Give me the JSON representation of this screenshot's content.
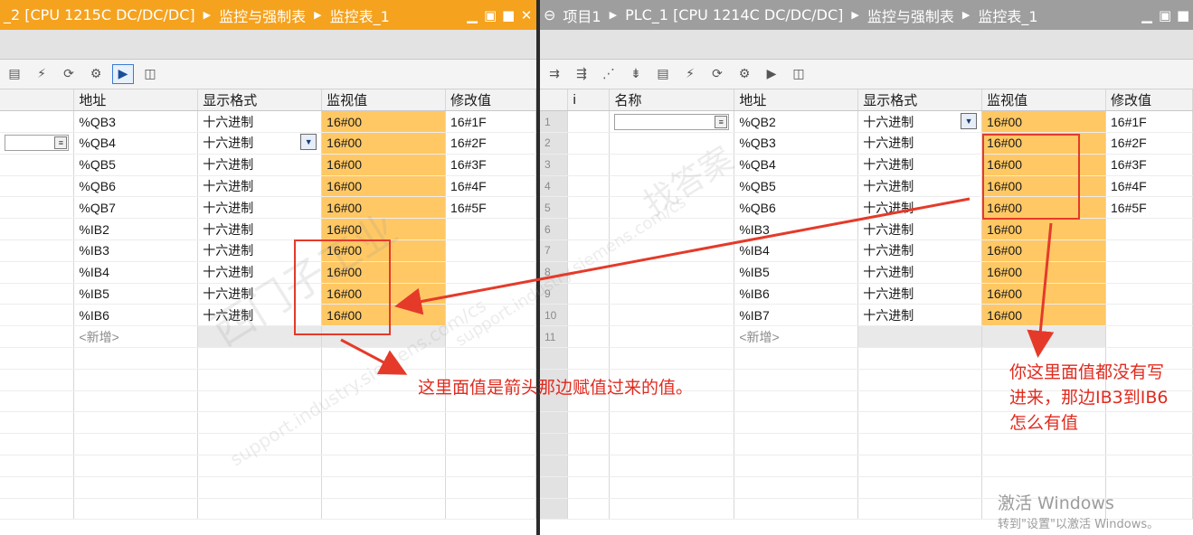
{
  "left": {
    "breadcrumb": [
      "_2 [CPU 1215C DC/DC/DC]",
      "监控与强制表",
      "监控表_1"
    ],
    "headers": [
      "地址",
      "显示格式",
      "监视值",
      "修改值"
    ],
    "rows": [
      {
        "addr": "%QB3",
        "fmt": "十六进制",
        "mon": "16#00",
        "mod": "16#1F"
      },
      {
        "addr": "%QB4",
        "fmt": "十六进制",
        "mon": "16#00",
        "mod": "16#2F"
      },
      {
        "addr": "%QB5",
        "fmt": "十六进制",
        "mon": "16#00",
        "mod": "16#3F"
      },
      {
        "addr": "%QB6",
        "fmt": "十六进制",
        "mon": "16#00",
        "mod": "16#4F"
      },
      {
        "addr": "%QB7",
        "fmt": "十六进制",
        "mon": "16#00",
        "mod": "16#5F"
      },
      {
        "addr": "%IB2",
        "fmt": "十六进制",
        "mon": "16#00",
        "mod": ""
      },
      {
        "addr": "%IB3",
        "fmt": "十六进制",
        "mon": "16#00",
        "mod": ""
      },
      {
        "addr": "%IB4",
        "fmt": "十六进制",
        "mon": "16#00",
        "mod": ""
      },
      {
        "addr": "%IB5",
        "fmt": "十六进制",
        "mon": "16#00",
        "mod": ""
      },
      {
        "addr": "%IB6",
        "fmt": "十六进制",
        "mon": "16#00",
        "mod": ""
      }
    ],
    "new_row": "<新增>"
  },
  "right": {
    "breadcrumb": [
      "项目1",
      "PLC_1 [CPU 1214C DC/DC/DC]",
      "监控与强制表",
      "监控表_1"
    ],
    "headers": [
      "i",
      "名称",
      "地址",
      "显示格式",
      "监视值",
      "修改值"
    ],
    "rows": [
      {
        "n": "1",
        "addr": "%QB2",
        "fmt": "十六进制",
        "mon": "16#00",
        "mod": "16#1F"
      },
      {
        "n": "2",
        "addr": "%QB3",
        "fmt": "十六进制",
        "mon": "16#00",
        "mod": "16#2F"
      },
      {
        "n": "3",
        "addr": "%QB4",
        "fmt": "十六进制",
        "mon": "16#00",
        "mod": "16#3F"
      },
      {
        "n": "4",
        "addr": "%QB5",
        "fmt": "十六进制",
        "mon": "16#00",
        "mod": "16#4F"
      },
      {
        "n": "5",
        "addr": "%QB6",
        "fmt": "十六进制",
        "mon": "16#00",
        "mod": "16#5F"
      },
      {
        "n": "6",
        "addr": "%IB3",
        "fmt": "十六进制",
        "mon": "16#00",
        "mod": ""
      },
      {
        "n": "7",
        "addr": "%IB4",
        "fmt": "十六进制",
        "mon": "16#00",
        "mod": ""
      },
      {
        "n": "8",
        "addr": "%IB5",
        "fmt": "十六进制",
        "mon": "16#00",
        "mod": ""
      },
      {
        "n": "9",
        "addr": "%IB6",
        "fmt": "十六进制",
        "mon": "16#00",
        "mod": ""
      },
      {
        "n": "10",
        "addr": "%IB7",
        "fmt": "十六进制",
        "mon": "16#00",
        "mod": ""
      }
    ],
    "new_row_num": "11",
    "new_row": "<新增>"
  },
  "annotations": {
    "left_note": "这里面值是箭头那边赋值过来的值。",
    "right_note_lines": [
      "你这里面值都没有写",
      "进来，那边IB3到IB6",
      "怎么有值"
    ]
  },
  "watermarks": {
    "brand_1": "西门子工业",
    "site_1": "support.industry.siemens.com/cs",
    "brand_2": "找答案",
    "site_2": "support.industry.siemens.com/cs"
  },
  "windows_activation": {
    "title": "激活 Windows",
    "subtitle": "转到\"设置\"以激活 Windows。"
  },
  "colors": {
    "left_titlebar": "#f5a21e",
    "right_titlebar": "#9e9e9e",
    "monitor_cell": "#ffc864",
    "annotation_red": "#e02b1f"
  }
}
